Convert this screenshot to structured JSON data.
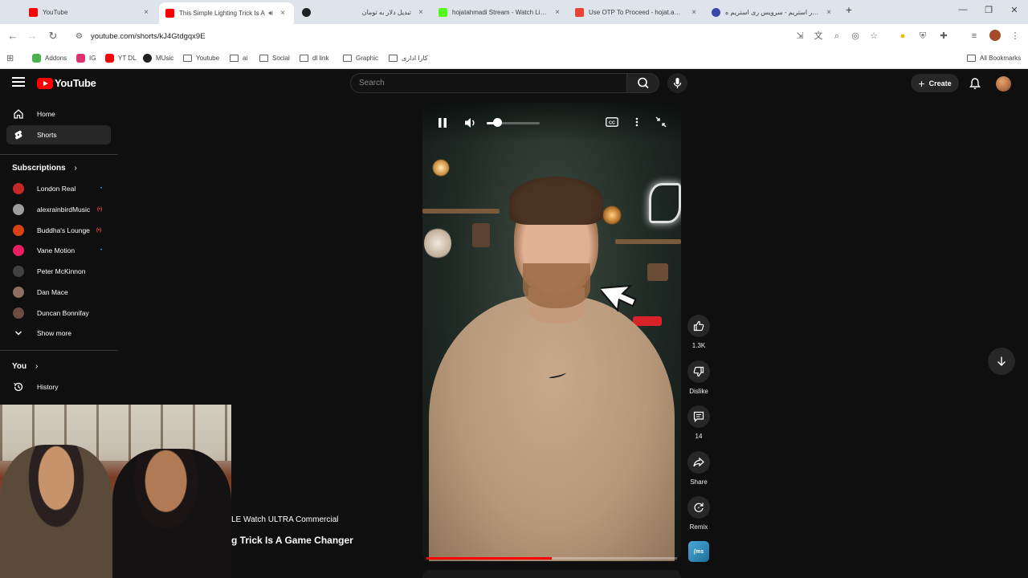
{
  "browser": {
    "tabs": [
      {
        "title": "YouTube",
        "favicon_color": "#ff0000",
        "active": false
      },
      {
        "title": "This Simple Lighting Trick Is A",
        "favicon_color": "#ff0000",
        "active": true
      },
      {
        "title": "",
        "favicon_color": "#202124",
        "active": false
      },
      {
        "title": "تبدیل دلار به تومان",
        "favicon_color": "#f2f2f2",
        "active": false
      },
      {
        "title": "hojatahmadi Stream - Watch Live o",
        "favicon_color": "#53fc18",
        "active": false
      },
      {
        "title": "Use OTP To Proceed - hojat.amd9",
        "favicon_color": "#ea4335",
        "active": false
      },
      {
        "title": "سمسار استریم - سرویس ری استریم ه",
        "favicon_color": "#3949ab",
        "active": false
      }
    ],
    "tab_close_glyph": "×",
    "new_tab_glyph": "+",
    "url": "youtube.com/shorts/kJ4Gtdgqx9E",
    "bookmarks": [
      {
        "label": "Addons",
        "icon": "puzzle-icon",
        "color": "#4caf50"
      },
      {
        "label": "IG",
        "icon": "instagram-icon",
        "color": "#e1306c"
      },
      {
        "label": "YT DL",
        "icon": "youtube-icon",
        "color": "#ff0000"
      },
      {
        "label": "MUsic",
        "icon": "github-icon",
        "color": "#202124"
      },
      {
        "label": "Youtube",
        "icon": "folder-icon",
        "color": ""
      },
      {
        "label": "ai",
        "icon": "folder-icon",
        "color": ""
      },
      {
        "label": "Social",
        "icon": "folder-icon",
        "color": ""
      },
      {
        "label": "dl link",
        "icon": "folder-icon",
        "color": ""
      },
      {
        "label": "Graphic",
        "icon": "folder-icon",
        "color": ""
      },
      {
        "label": "کارا اداری",
        "icon": "folder-icon",
        "color": ""
      }
    ],
    "all_bookmarks": "All Bookmarks"
  },
  "yt": {
    "logo_text": "YouTube",
    "search_placeholder": "Search",
    "create_label": "Create",
    "sidebar": {
      "home": "Home",
      "shorts": "Shorts",
      "subscriptions_heading": "Subscriptions",
      "subscriptions": [
        {
          "name": "London Real",
          "indicator": "•",
          "indicator_type": "dot",
          "avatar_color": "#c62828"
        },
        {
          "name": "alexrainbirdMusic",
          "indicator": "(•)",
          "indicator_type": "live",
          "avatar_color": "#9e9e9e"
        },
        {
          "name": "Buddha's Lounge",
          "indicator": "(•)",
          "indicator_type": "live",
          "avatar_color": "#d84315"
        },
        {
          "name": "Vane Motion",
          "indicator": "•",
          "indicator_type": "dot",
          "avatar_color": "#e91e63"
        },
        {
          "name": "Peter McKinnon",
          "indicator": "",
          "indicator_type": "none",
          "avatar_color": "#424242"
        },
        {
          "name": "Dan Mace",
          "indicator": "",
          "indicator_type": "none",
          "avatar_color": "#8d6e63"
        },
        {
          "name": "Duncan Bonnifay",
          "indicator": "",
          "indicator_type": "none",
          "avatar_color": "#6d4c41"
        }
      ],
      "show_more": "Show more",
      "you_heading": "You",
      "history": "History"
    },
    "short": {
      "progress_fraction": 0.5,
      "volume_fraction": 0.2,
      "actions": {
        "like_count": "1.3K",
        "dislike_label": "Dislike",
        "comment_count": "14",
        "share_label": "Share",
        "remix_label": "Remix"
      },
      "audio_thumb_text": "(ms"
    },
    "prev_short": {
      "line1": "LE Watch ULTRA Commercial",
      "line2": "g Trick Is A Game Changer"
    }
  },
  "colors": {
    "yt_red": "#ff0000",
    "bg": "#0f0f0f",
    "chrome_tabbar": "#dfe3eb"
  }
}
